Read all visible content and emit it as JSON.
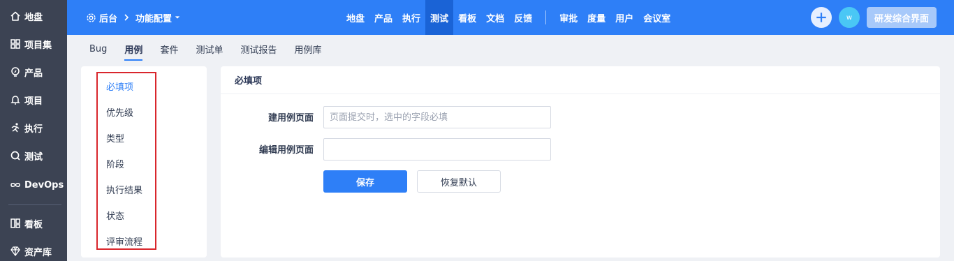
{
  "sidebar": {
    "items": [
      {
        "label": "地盘",
        "icon": "home-icon"
      },
      {
        "label": "项目集",
        "icon": "grid-icon"
      },
      {
        "label": "产品",
        "icon": "lightbulb-icon"
      },
      {
        "label": "项目",
        "icon": "bell-icon"
      },
      {
        "label": "执行",
        "icon": "run-icon"
      },
      {
        "label": "测试",
        "icon": "search-icon"
      },
      {
        "label": "DevOps",
        "icon": "infinity-icon"
      },
      {
        "label": "看板",
        "icon": "board-icon"
      },
      {
        "label": "资产库",
        "icon": "diamond-icon"
      }
    ]
  },
  "header": {
    "breadcrumb_home": "后台",
    "breadcrumb_current": "功能配置",
    "nav": [
      "地盘",
      "产品",
      "执行",
      "测试",
      "看板",
      "文档",
      "反馈"
    ],
    "nav_active": "测试",
    "nav_secondary": [
      "审批",
      "度量",
      "用户",
      "会议室"
    ],
    "avatar_text": "w",
    "ui_button": "研发综合界面",
    "accent": "#2e7ff7"
  },
  "subtabs": {
    "items": [
      "Bug",
      "用例",
      "套件",
      "测试单",
      "测试报告",
      "用例库"
    ],
    "active": "用例"
  },
  "left_menu": {
    "items": [
      "必填项",
      "优先级",
      "类型",
      "阶段",
      "执行结果",
      "状态",
      "评审流程"
    ],
    "active": "必填项"
  },
  "panel": {
    "title": "必填项",
    "field1_label": "建用例页面",
    "field1_placeholder": "页面提交时，选中的字段必填",
    "field2_label": "编辑用例页面",
    "field2_value": "",
    "save_label": "保存",
    "reset_label": "恢复默认"
  }
}
